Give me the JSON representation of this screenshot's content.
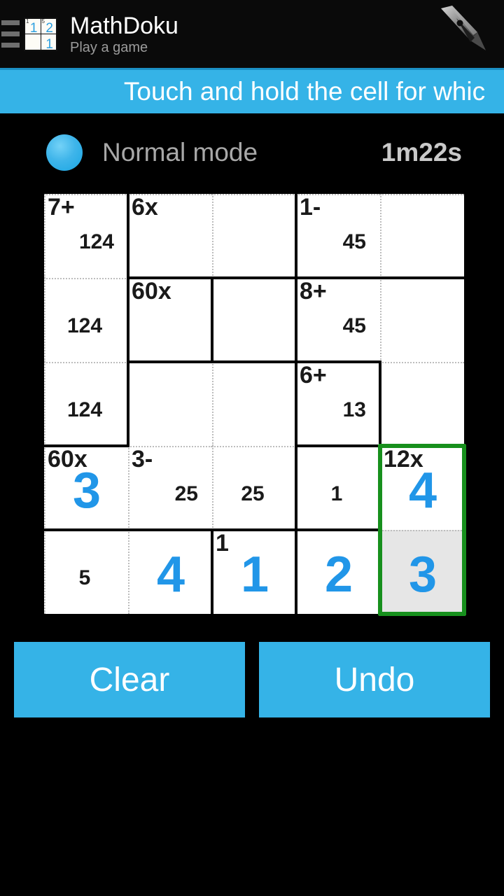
{
  "app": {
    "title": "MathDoku",
    "subtitle": "Play a game",
    "drawer_icon": "hamburger-icon",
    "pen_icon": "pen-nib-icon",
    "icon_cells": [
      {
        "big": "1",
        "small": "1"
      },
      {
        "big": "2",
        "small": "5"
      },
      {
        "big": "",
        "small": ""
      },
      {
        "big": "1",
        "small": ""
      }
    ]
  },
  "banner": {
    "text": "Touch and hold the cell for whic"
  },
  "status": {
    "mode": "Normal mode",
    "timer": "1m22s",
    "dot_color": "#3fb5ea"
  },
  "colors": {
    "accent": "#35b3e7",
    "value_blue": "#2196e8",
    "selection_green": "#17901d",
    "selected_cell_bg": "#e6e6e6"
  },
  "grid": {
    "size": 5,
    "cells": [
      {
        "r": 1,
        "c": 1,
        "cage": "7+",
        "value": "",
        "maybes": "124",
        "maybes_align": "right",
        "selected": false
      },
      {
        "r": 1,
        "c": 2,
        "cage": "6x",
        "value": "",
        "maybes": "",
        "maybes_align": "center",
        "selected": false
      },
      {
        "r": 1,
        "c": 3,
        "cage": "",
        "value": "",
        "maybes": "",
        "maybes_align": "center",
        "selected": false
      },
      {
        "r": 1,
        "c": 4,
        "cage": "1-",
        "value": "",
        "maybes": "45",
        "maybes_align": "right",
        "selected": false
      },
      {
        "r": 1,
        "c": 5,
        "cage": "",
        "value": "",
        "maybes": "",
        "maybes_align": "center",
        "selected": false
      },
      {
        "r": 2,
        "c": 1,
        "cage": "",
        "value": "",
        "maybes": "124",
        "maybes_align": "center",
        "selected": false
      },
      {
        "r": 2,
        "c": 2,
        "cage": "60x",
        "value": "",
        "maybes": "",
        "maybes_align": "center",
        "selected": false
      },
      {
        "r": 2,
        "c": 3,
        "cage": "",
        "value": "",
        "maybes": "",
        "maybes_align": "center",
        "selected": false
      },
      {
        "r": 2,
        "c": 4,
        "cage": "8+",
        "value": "",
        "maybes": "45",
        "maybes_align": "right",
        "selected": false
      },
      {
        "r": 2,
        "c": 5,
        "cage": "",
        "value": "",
        "maybes": "",
        "maybes_align": "center",
        "selected": false
      },
      {
        "r": 3,
        "c": 1,
        "cage": "",
        "value": "",
        "maybes": "124",
        "maybes_align": "center",
        "selected": false
      },
      {
        "r": 3,
        "c": 2,
        "cage": "",
        "value": "",
        "maybes": "",
        "maybes_align": "center",
        "selected": false
      },
      {
        "r": 3,
        "c": 3,
        "cage": "",
        "value": "",
        "maybes": "",
        "maybes_align": "center",
        "selected": false
      },
      {
        "r": 3,
        "c": 4,
        "cage": "6+",
        "value": "",
        "maybes": "13",
        "maybes_align": "right",
        "selected": false
      },
      {
        "r": 3,
        "c": 5,
        "cage": "",
        "value": "",
        "maybes": "",
        "maybes_align": "center",
        "selected": false
      },
      {
        "r": 4,
        "c": 1,
        "cage": "60x",
        "value": "3",
        "maybes": "",
        "maybes_align": "center",
        "selected": false
      },
      {
        "r": 4,
        "c": 2,
        "cage": "3-",
        "value": "",
        "maybes": "25",
        "maybes_align": "right",
        "selected": false
      },
      {
        "r": 4,
        "c": 3,
        "cage": "",
        "value": "",
        "maybes": "25",
        "maybes_align": "center",
        "selected": false
      },
      {
        "r": 4,
        "c": 4,
        "cage": "",
        "value": "",
        "maybes": "1",
        "maybes_align": "center",
        "selected": false
      },
      {
        "r": 4,
        "c": 5,
        "cage": "12x",
        "value": "4",
        "maybes": "",
        "maybes_align": "center",
        "selected": false
      },
      {
        "r": 5,
        "c": 1,
        "cage": "",
        "value": "",
        "maybes": "5",
        "maybes_align": "center",
        "selected": false
      },
      {
        "r": 5,
        "c": 2,
        "cage": "",
        "value": "4",
        "maybes": "",
        "maybes_align": "center",
        "selected": false
      },
      {
        "r": 5,
        "c": 3,
        "cage": "1",
        "value": "1",
        "maybes": "",
        "maybes_align": "center",
        "selected": false
      },
      {
        "r": 5,
        "c": 4,
        "cage": "",
        "value": "2",
        "maybes": "",
        "maybes_align": "center",
        "selected": false
      },
      {
        "r": 5,
        "c": 5,
        "cage": "",
        "value": "3",
        "maybes": "",
        "maybes_align": "center",
        "selected": true
      }
    ]
  },
  "controls": {
    "clear_label": "Clear",
    "undo_label": "Undo"
  }
}
